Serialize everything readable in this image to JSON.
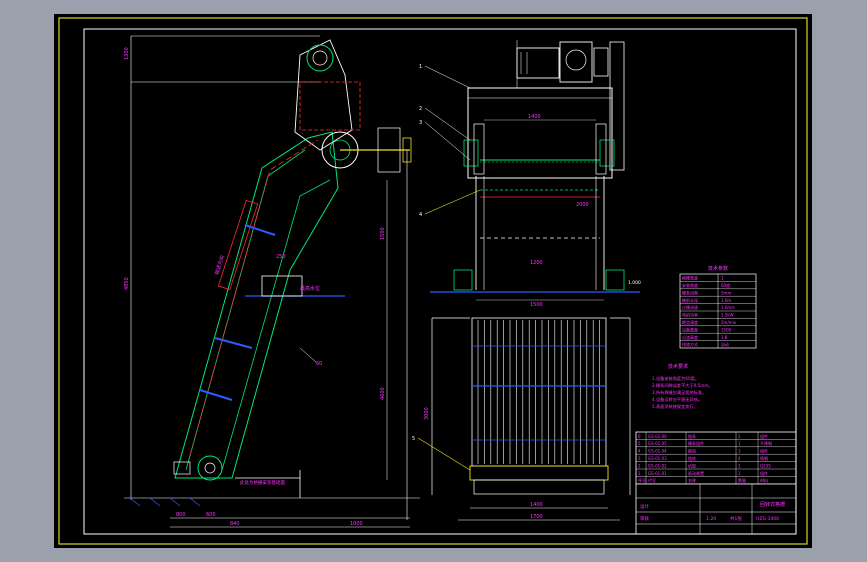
{
  "drawing": {
    "background": "#000000",
    "frame_color": "#d4d72a",
    "page_color": "#9aa1ad",
    "colors": {
      "white": "#ffffff",
      "green": "#00e676",
      "red": "#ff2a2a",
      "blue": "#2f5bff",
      "magenta": "#ff33ff",
      "yellow": "#f3e21c",
      "cyan": "#36e0ff"
    }
  },
  "left_view": {
    "dims": {
      "top_height": "1300",
      "overall_height": "4850",
      "mid_height": "1500",
      "lower_height": "4600",
      "bottom_a": "800",
      "bottom_b": "600",
      "bottom_c": "1000",
      "bottom_d": "840",
      "angle": "60",
      "slot": "250"
    },
    "annotations": {
      "pivot_label": "输送方向",
      "level_label": "最高水位",
      "bottom_label": "此处为格栅安装基础面"
    }
  },
  "right_view": {
    "dims": {
      "top_width": "1400",
      "mid_width": "2000",
      "rake_width": "1200",
      "channel_width": "1500",
      "base_width": "1400",
      "base_outer": "1700",
      "depth": "3000"
    },
    "balloons": [
      "1",
      "2",
      "3",
      "4",
      "5"
    ],
    "level_label": "1.000"
  },
  "params_table": {
    "title": "技术参数",
    "rows": [
      [
        "格栅宽度",
        "1"
      ],
      [
        "安装角度",
        "60度"
      ],
      [
        "栅条间隙",
        "5mm"
      ],
      [
        "栅前水深",
        "1.0m"
      ],
      [
        "过栅流速",
        "1.0m/s"
      ],
      [
        "电机功率",
        "1.5kW"
      ],
      [
        "耙齿速度",
        "2m/min"
      ],
      [
        "设备重量",
        "1500"
      ],
      [
        "出渣高度",
        "1.8"
      ],
      [
        "排渣方式",
        "自动"
      ]
    ]
  },
  "notes": {
    "title": "技术要求",
    "lines": [
      "1.设备安装角度为60度。",
      "2.栅条间隙误差不大于0.5mm。",
      "3.所有焊缝应满足相关标准。",
      "4.设备运转应平稳无异响。",
      "5.表面涂装按规定执行。"
    ]
  },
  "bom": {
    "rows": [
      [
        "6",
        "GS-01-06",
        "链条",
        "2",
        "组件"
      ],
      [
        "5",
        "GS-01-05",
        "栅条组件",
        "1",
        "不锈钢"
      ],
      [
        "4",
        "GS-01-04",
        "耙齿",
        "1",
        "组件"
      ],
      [
        "3",
        "GS-01-03",
        "链轮",
        "4",
        "铸钢"
      ],
      [
        "2",
        "GS-01-02",
        "机架",
        "1",
        "Q235"
      ],
      [
        "1",
        "GS-01-01",
        "驱动装置",
        "1",
        "组件"
      ]
    ],
    "header": [
      "序号",
      "代号",
      "名称",
      "数量",
      "材料"
    ]
  },
  "title_block": {
    "name": "回转式格栅",
    "drawing_no": "HZG-1000",
    "scale": "1:20",
    "sheet": "共1张",
    "designer": "设计",
    "checker": "审核"
  }
}
